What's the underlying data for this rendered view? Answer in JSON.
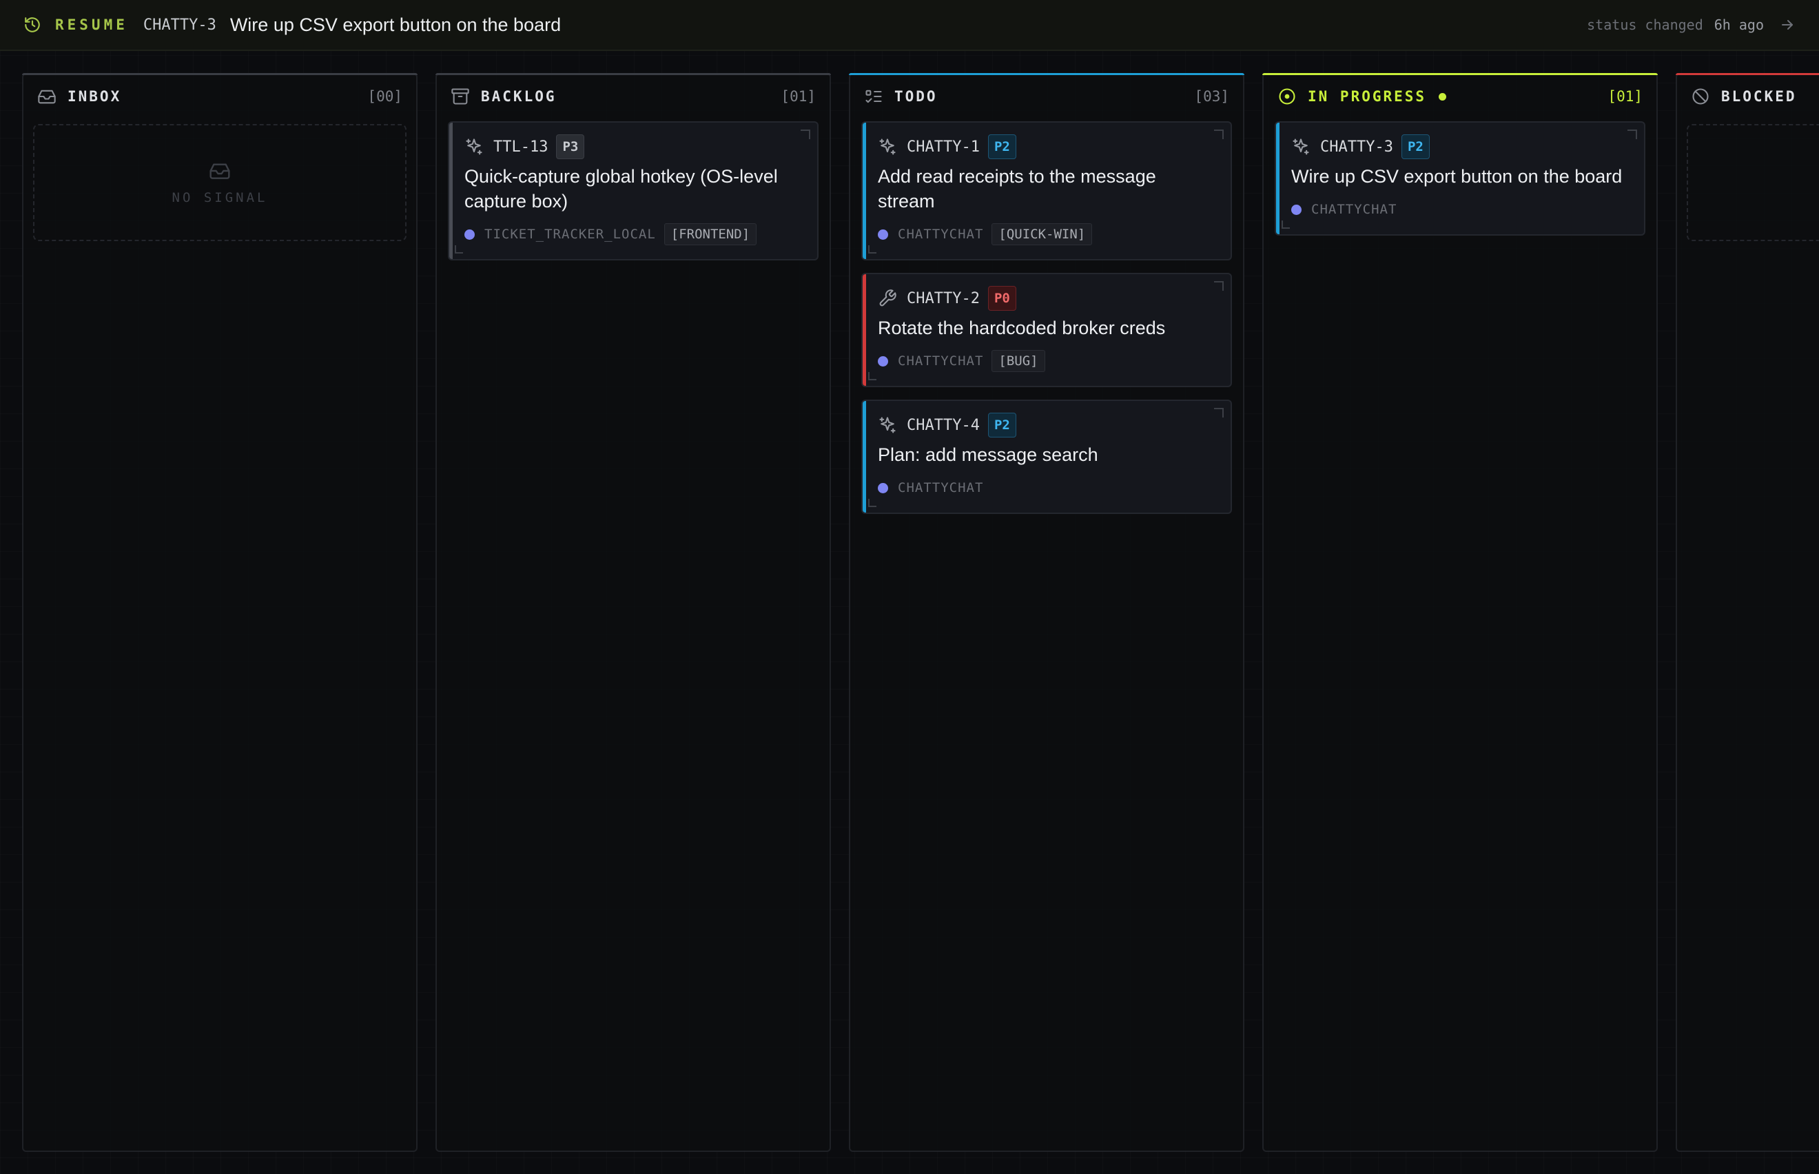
{
  "resume_bar": {
    "label": "RESUME",
    "ticket_id": "CHATTY-3",
    "ticket_title": "Wire up CSV export button on the board",
    "status_text": "status changed",
    "status_ago": "6h ago",
    "accent_color": "#a6c64a"
  },
  "columns": [
    {
      "name": "INBOX",
      "count": "[00]",
      "icon": "inbox-icon",
      "empty_text": "NO SIGNAL",
      "cards": []
    },
    {
      "name": "BACKLOG",
      "count": "[01]",
      "icon": "archive-icon",
      "cards": [
        {
          "id": "TTL-13",
          "priority": "P3",
          "title": "Quick-capture global hotkey (OS-level capture box)",
          "project": "TICKET_TRACKER_LOCAL",
          "tags": [
            "[FRONTEND]"
          ],
          "icon": "sparkle-icon"
        }
      ]
    },
    {
      "name": "TODO",
      "count": "[03]",
      "icon": "list-todo-icon",
      "accent_color": "#1e9fd6",
      "cards": [
        {
          "id": "CHATTY-1",
          "priority": "P2",
          "title": "Add read receipts to the message stream",
          "project": "CHATTYCHAT",
          "tags": [
            "[QUICK-WIN]"
          ],
          "icon": "sparkle-icon"
        },
        {
          "id": "CHATTY-2",
          "priority": "P0",
          "title": "Rotate the hardcoded broker creds",
          "project": "CHATTYCHAT",
          "tags": [
            "[BUG]"
          ],
          "icon": "wrench-icon"
        },
        {
          "id": "CHATTY-4",
          "priority": "P2",
          "title": "Plan: add message search",
          "project": "CHATTYCHAT",
          "tags": [],
          "icon": "sparkle-icon"
        }
      ]
    },
    {
      "name": "IN PROGRESS",
      "count": "[01]",
      "icon": "circle-dot-icon",
      "accent_color": "#c8ef3a",
      "cards": [
        {
          "id": "CHATTY-3",
          "priority": "P2",
          "title": "Wire up CSV export button on the board",
          "project": "CHATTYCHAT",
          "tags": [],
          "icon": "sparkle-icon"
        }
      ]
    },
    {
      "name": "BLOCKED",
      "count": "",
      "icon": "ban-icon",
      "accent_color": "#d23a3a",
      "cards": []
    }
  ]
}
